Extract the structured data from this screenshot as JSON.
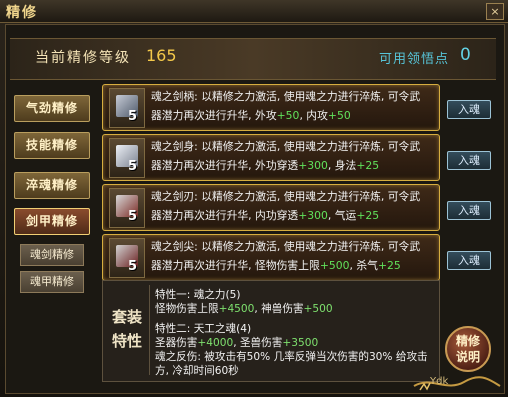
{
  "window": {
    "title": "精修",
    "close": "×"
  },
  "header": {
    "level_label": "当前精修等级",
    "level_value": "165",
    "points_label": "可用领悟点",
    "points_value": "0"
  },
  "nav": {
    "items": [
      {
        "label": "气劲精修"
      },
      {
        "label": "技能精修"
      },
      {
        "label": "淬魂精修"
      },
      {
        "label": "剑甲精修"
      }
    ],
    "subitems": [
      {
        "label": "魂剑精修"
      },
      {
        "label": "魂甲精修"
      }
    ]
  },
  "cards": [
    {
      "level": "5",
      "line1": "魂之剑柄: 以精修之力激活, 使用魂之力进行淬炼, 可令武",
      "line2_prefix": "器潜力再次进行升华, 外攻",
      "bonus1": "+50",
      "line2_mid": ", 内攻",
      "bonus2": "+50",
      "button": "入魂"
    },
    {
      "level": "5",
      "line1": "魂之剑身: 以精修之力激活, 使用魂之力进行淬炼, 可令武",
      "line2_prefix": "器潜力再次进行升华, 外功穿透",
      "bonus1": "+300",
      "line2_mid": ", 身法",
      "bonus2": "+25",
      "button": "入魂"
    },
    {
      "level": "5",
      "line1": "魂之剑刃: 以精修之力激活, 使用魂之力进行淬炼, 可令武",
      "line2_prefix": "器潜力再次进行升华, 内功穿透",
      "bonus1": "+300",
      "line2_mid": ", 气运",
      "bonus2": "+25",
      "button": "入魂"
    },
    {
      "level": "5",
      "line1": "魂之剑尖: 以精修之力激活, 使用魂之力进行淬炼, 可令武",
      "line2_prefix": "器潜力再次进行升华, 怪物伤害上限",
      "bonus1": "+500",
      "line2_mid": ", 杀气",
      "bonus2": "+25",
      "button": "入魂"
    }
  ],
  "set": {
    "label_top": "套装",
    "label_bottom": "特性",
    "feature1_title": "特性一: 魂之力(5)",
    "feature1_line1_prefix": "怪物伤害上限",
    "feature1_line1_value": "+4500",
    "feature1_line1_mid": ", 神兽伤害",
    "feature1_line1_value2": "+500",
    "feature2_title": "特性二: 天工之魂(4)",
    "feature2_line1_prefix": "圣器伤害",
    "feature2_line1_value": "+4000",
    "feature2_line1_mid": ", 圣兽伤害",
    "feature2_line1_value2": "+3500",
    "feature2_line2": "魂之反伤: 被攻击有50% 几率反弹当次伤害的30% 给攻击",
    "feature2_line3": "方, 冷却时间60秒"
  },
  "help": {
    "top": "精修",
    "bottom": "说明"
  },
  "logo": {
    "text": "Ydk"
  }
}
